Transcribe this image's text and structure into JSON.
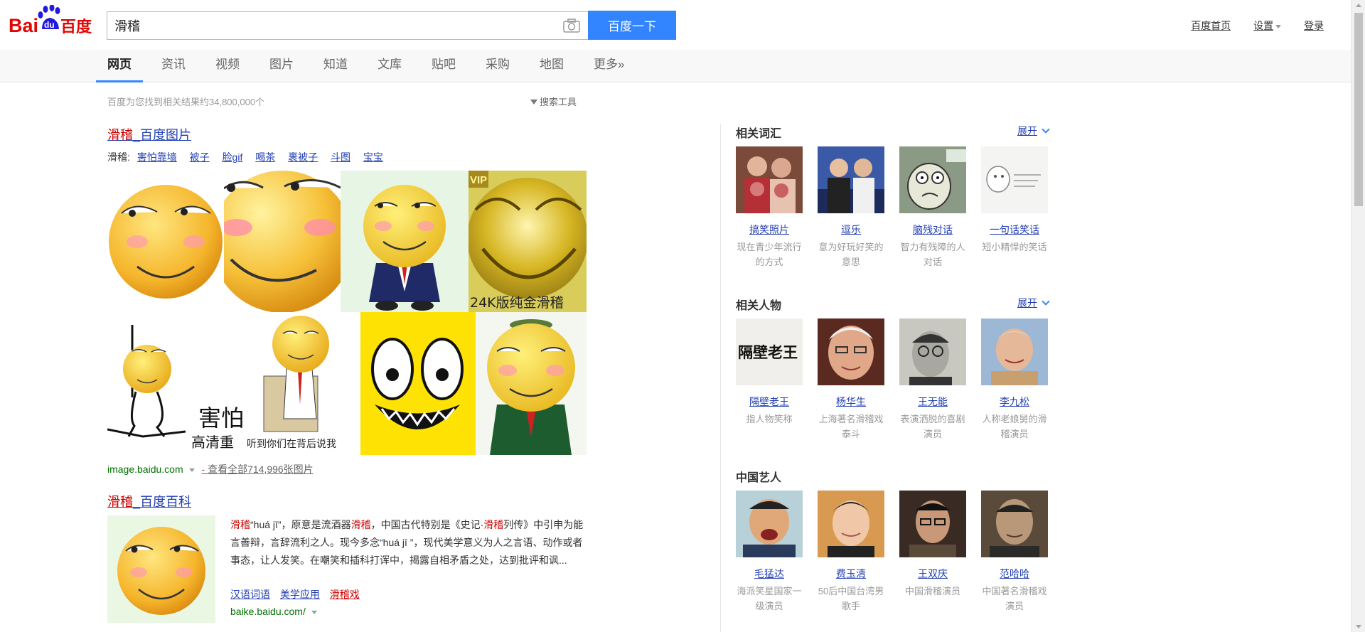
{
  "header": {
    "logo_text_left": "Bai",
    "logo_text_paw": "du",
    "logo_text_right": "百度",
    "query": "滑稽",
    "search_button": "百度一下",
    "links": [
      "百度首页",
      "设置",
      "登录"
    ]
  },
  "tabs": [
    "网页",
    "资讯",
    "视频",
    "图片",
    "知道",
    "文库",
    "贴吧",
    "采购",
    "地图",
    "更多»"
  ],
  "results_meta": {
    "count_text": "百度为您找到相关结果约34,800,000个",
    "tools_label": "搜索工具"
  },
  "image_result": {
    "title_hl": "滑稽",
    "title_rest": "_百度图片",
    "sub_prefix": "滑稽:",
    "sub_links": [
      "害怕靠墙",
      "被子",
      "脸gif",
      "喝茶",
      "裹被子",
      "斗图",
      "宝宝"
    ],
    "source": "image.baidu.com",
    "view_all": "- 查看全部714,996张图片",
    "thumb_captions": {
      "gold": "24K版纯金滑稽",
      "gold_badge": "VIP",
      "scared_line1": "害怕",
      "scared_line2": "高清重",
      "paper": "听到你们在背后说我"
    }
  },
  "baike_result": {
    "title_hl": "滑稽",
    "title_rest": "_百度百科",
    "abstract": [
      {
        "t": "滑稽",
        "hl": true
      },
      {
        "t": "“huá jī”，原意是流酒器",
        "hl": false
      },
      {
        "t": "滑稽",
        "hl": true
      },
      {
        "t": "，中国古代特别是《史记·",
        "hl": false
      },
      {
        "t": "滑稽",
        "hl": true
      },
      {
        "t": "列传》中引申为能言善辩，言辞流利之人。现今多念“huá jī ”，现代美学意义为人之言语、动作或者事态，让人发笑。在嘲笑和插科打诨中，揭露自相矛盾之处，达到批评和讽...",
        "hl": false
      }
    ],
    "links": [
      {
        "label": "汉语词语",
        "hl": false
      },
      {
        "label": "美学应用",
        "hl": false
      },
      {
        "label": "滑稽戏",
        "hl": true
      }
    ],
    "source": "baike.baidu.com/"
  },
  "sidebar": {
    "expand_label": "展开",
    "sections": [
      {
        "heading": "相关词汇",
        "has_expand": true,
        "items": [
          {
            "name": "搞笑照片",
            "desc": "现在青少年流行的方式"
          },
          {
            "name": "逗乐",
            "desc": "意为好玩好笑的意思"
          },
          {
            "name": "脑残对话",
            "desc": "智力有残障的人对话"
          },
          {
            "name": "一句话笑话",
            "desc": "短小精悍的笑话"
          }
        ]
      },
      {
        "heading": "相关人物",
        "has_expand": true,
        "items": [
          {
            "name": "隔壁老王",
            "desc": "指人物笑称",
            "pic_text": "隔壁老王"
          },
          {
            "name": "杨华生",
            "desc": "上海著名滑稽戏泰斗"
          },
          {
            "name": "王无能",
            "desc": "表演洒脱的喜剧演员"
          },
          {
            "name": "李九松",
            "desc": "人称老娘舅的滑稽演员"
          }
        ]
      },
      {
        "heading": "中国艺人",
        "has_expand": false,
        "items": [
          {
            "name": "毛猛达",
            "desc": "海派笑星国家一级演员"
          },
          {
            "name": "费玉清",
            "desc": "50后中国台湾男歌手"
          },
          {
            "name": "王双庆",
            "desc": "中国滑稽演员"
          },
          {
            "name": "范哈哈",
            "desc": "中国著名滑稽戏演员"
          }
        ]
      }
    ]
  },
  "colors": {
    "accent": "#3385ff",
    "link": "#2440b3",
    "highlight": "#cc0000",
    "url_green": "#007000",
    "logo_red": "#e10602",
    "logo_blue": "#2319dc"
  }
}
